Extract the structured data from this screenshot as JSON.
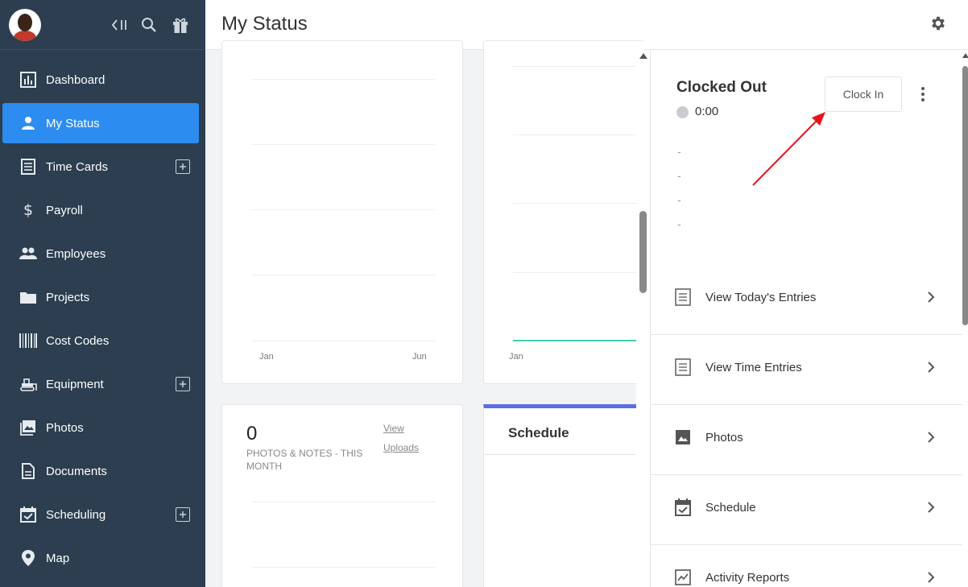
{
  "sidebar": {
    "items": [
      {
        "label": "Dashboard",
        "icon": "bar-chart-icon",
        "active": false,
        "add": false
      },
      {
        "label": "My Status",
        "icon": "person-icon",
        "active": true,
        "add": false
      },
      {
        "label": "Time Cards",
        "icon": "document-icon",
        "active": false,
        "add": true
      },
      {
        "label": "Payroll",
        "icon": "dollar-icon",
        "active": false,
        "add": false
      },
      {
        "label": "Employees",
        "icon": "group-icon",
        "active": false,
        "add": false
      },
      {
        "label": "Projects",
        "icon": "folder-icon",
        "active": false,
        "add": false
      },
      {
        "label": "Cost Codes",
        "icon": "barcode-icon",
        "active": false,
        "add": false
      },
      {
        "label": "Equipment",
        "icon": "bulldozer-icon",
        "active": false,
        "add": true
      },
      {
        "label": "Photos",
        "icon": "photo-icon",
        "active": false,
        "add": false
      },
      {
        "label": "Documents",
        "icon": "file-icon",
        "active": false,
        "add": false
      },
      {
        "label": "Scheduling",
        "icon": "calendar-check-icon",
        "active": false,
        "add": true
      },
      {
        "label": "Map",
        "icon": "map-pin-icon",
        "active": false,
        "add": false
      }
    ]
  },
  "header": {
    "title": "My Status"
  },
  "cards": {
    "chart_left": {
      "x_ticks": [
        "Jan",
        "Jun"
      ]
    },
    "chart_right": {
      "x_ticks": [
        "Jan"
      ],
      "line_color": "#3ecfb2"
    },
    "photos": {
      "count": "0",
      "label": "PHOTOS & NOTES - THIS MONTH",
      "view_link_1": "View",
      "view_link_2": "Uploads"
    },
    "schedule": {
      "title": "Schedule",
      "accent_color": "#5b6ee8"
    }
  },
  "panel": {
    "status": "Clocked Out",
    "time": "0:00",
    "clock_in_label": "Clock In",
    "details": [
      "-",
      "-",
      "-",
      "-"
    ],
    "rows": [
      {
        "label": "View Today's Entries",
        "icon": "list-icon"
      },
      {
        "label": "View Time Entries",
        "icon": "list-icon"
      },
      {
        "label": "Photos",
        "icon": "photo-icon"
      },
      {
        "label": "Schedule",
        "icon": "calendar-check-icon"
      },
      {
        "label": "Activity Reports",
        "icon": "trend-chart-icon"
      }
    ]
  },
  "colors": {
    "sidebar_bg": "#2c3e50",
    "active_blue": "#2d8cf0",
    "annotation_red": "#e8141c"
  }
}
